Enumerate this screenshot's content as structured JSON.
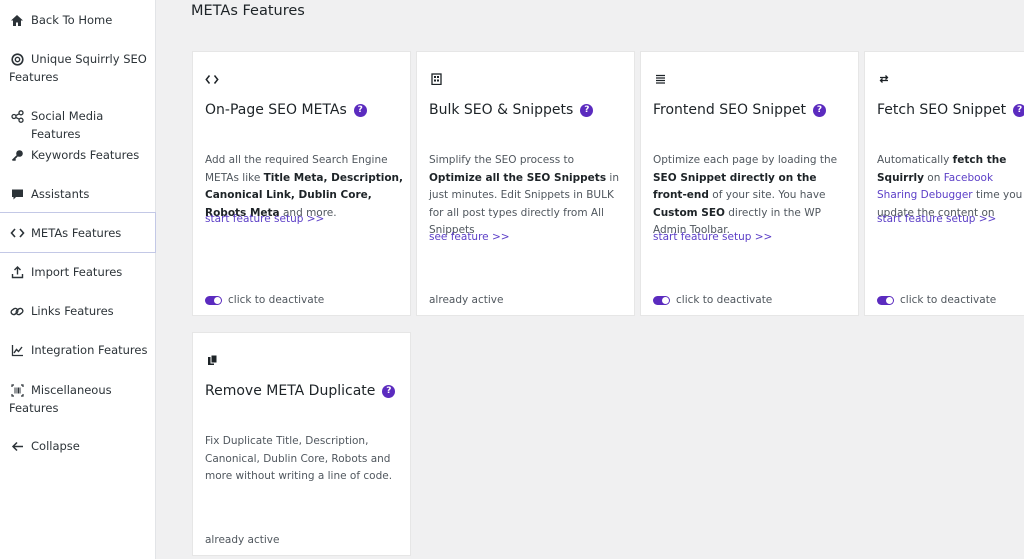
{
  "sidebar": {
    "items": [
      {
        "label": "Back To Home",
        "icon": "home-icon"
      },
      {
        "label": "Unique Squirrly SEO Features",
        "icon": "squirrly-logo-icon"
      },
      {
        "label": "Social Media Features",
        "icon": "share-icon"
      },
      {
        "label": "Keywords Features",
        "icon": "key-icon"
      },
      {
        "label": "Assistants",
        "icon": "chat-icon"
      },
      {
        "label": "METAs Features",
        "icon": "code-icon"
      },
      {
        "label": "Import Features",
        "icon": "upload-icon"
      },
      {
        "label": "Links Features",
        "icon": "link-icon"
      },
      {
        "label": "Integration Features",
        "icon": "chart-line-icon"
      },
      {
        "label": "Miscellaneous Features",
        "icon": "barcode-icon"
      },
      {
        "label": "Collapse",
        "icon": "arrow-left-icon"
      }
    ],
    "active_index": 5
  },
  "page": {
    "title": "METAs Features"
  },
  "cards": [
    {
      "title": "On-Page SEO METAs",
      "icon": "code-icon",
      "desc": [
        {
          "t": "Add all the required Search Engine METAs like "
        },
        {
          "t": "Title Meta, Description, Canonical Link, Dublin Core, Robots Meta",
          "b": true
        },
        {
          "t": " and more."
        }
      ],
      "link": "start feature setup >>",
      "footer": "click to deactivate",
      "footer_type": "toggle"
    },
    {
      "title": "Bulk SEO & Snippets",
      "icon": "building-icon",
      "desc": [
        {
          "t": "Simplify the SEO process to "
        },
        {
          "t": "Optimize all the SEO Snippets",
          "b": true
        },
        {
          "t": " in just minutes. Edit Snippets in BULK for all post types directly from All Snippets"
        }
      ],
      "link": "see feature >>",
      "footer": "already active",
      "footer_type": "text"
    },
    {
      "title": "Frontend SEO Snippet",
      "icon": "list-icon",
      "desc": [
        {
          "t": "Optimize each page by loading the "
        },
        {
          "t": "SEO Snippet directly on the front-end",
          "b": true
        },
        {
          "t": " of your site. You have "
        },
        {
          "t": "Custom SEO",
          "b": true
        },
        {
          "t": " directly in the WP Admin Toolbar."
        }
      ],
      "link": "start feature setup >>",
      "footer": "click to deactivate",
      "footer_type": "toggle"
    },
    {
      "title": "Fetch SEO Snippet",
      "icon": "refresh-icon",
      "desc": [
        {
          "t": "Automatically "
        },
        {
          "t": "fetch the Squirrly",
          "b": true
        },
        {
          "t": " on "
        },
        {
          "t": "Facebook Sharing Debugger",
          "link": true
        },
        {
          "t": " time you update the content on"
        }
      ],
      "link": "start feature setup >>",
      "footer": "click to deactivate",
      "footer_type": "toggle"
    },
    {
      "title": "Remove META Duplicate",
      "icon": "copy-icon",
      "desc": [
        {
          "t": "Fix Duplicate Title, Description, Canonical, Dublin Core, Robots and more without writing a line of code."
        }
      ],
      "link": "",
      "footer": "already active",
      "footer_type": "text"
    }
  ],
  "colors": {
    "accent": "#5b2bbf",
    "link": "#5b3ec7",
    "background": "#f0f0f1"
  }
}
